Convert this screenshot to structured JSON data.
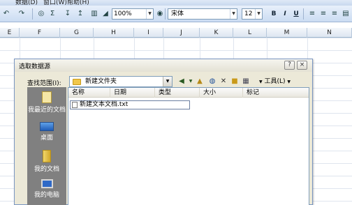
{
  "menu": {
    "items": [
      "数据(D)",
      "窗口(W)",
      "帮助(H)"
    ]
  },
  "toolbar": {
    "zoom": "100%",
    "font_name": "宋体",
    "font_size": "12",
    "bold": "B",
    "italic": "I",
    "underline": "U"
  },
  "columns": [
    "E",
    "F",
    "G",
    "H",
    "I",
    "J",
    "K",
    "L",
    "M",
    "N"
  ],
  "dialog": {
    "title": "选取数据源",
    "help_button": "?",
    "close_button": "×",
    "look_in_label": "查找范围(I):",
    "look_in_value": "新建文件夹",
    "tools_label": "工具(L)",
    "places": [
      "我最近的文档",
      "桌面",
      "我的文档",
      "我的电脑"
    ],
    "list_headers": [
      "名称",
      "日期",
      "类型",
      "大小",
      "标记"
    ],
    "files": [
      "新建文本文档.txt"
    ]
  },
  "colors": {
    "dialog_bg": "#ece9d8",
    "places_bar": "#808080",
    "toolbar_bg": "#cbdcf2"
  },
  "icons": [
    "folder-icon",
    "back-icon",
    "up-folder-icon",
    "search-web-icon",
    "delete-icon",
    "new-folder-icon",
    "views-icon",
    "recent-docs-icon",
    "desktop-icon",
    "my-documents-icon",
    "my-computer-icon",
    "text-file-icon"
  ]
}
